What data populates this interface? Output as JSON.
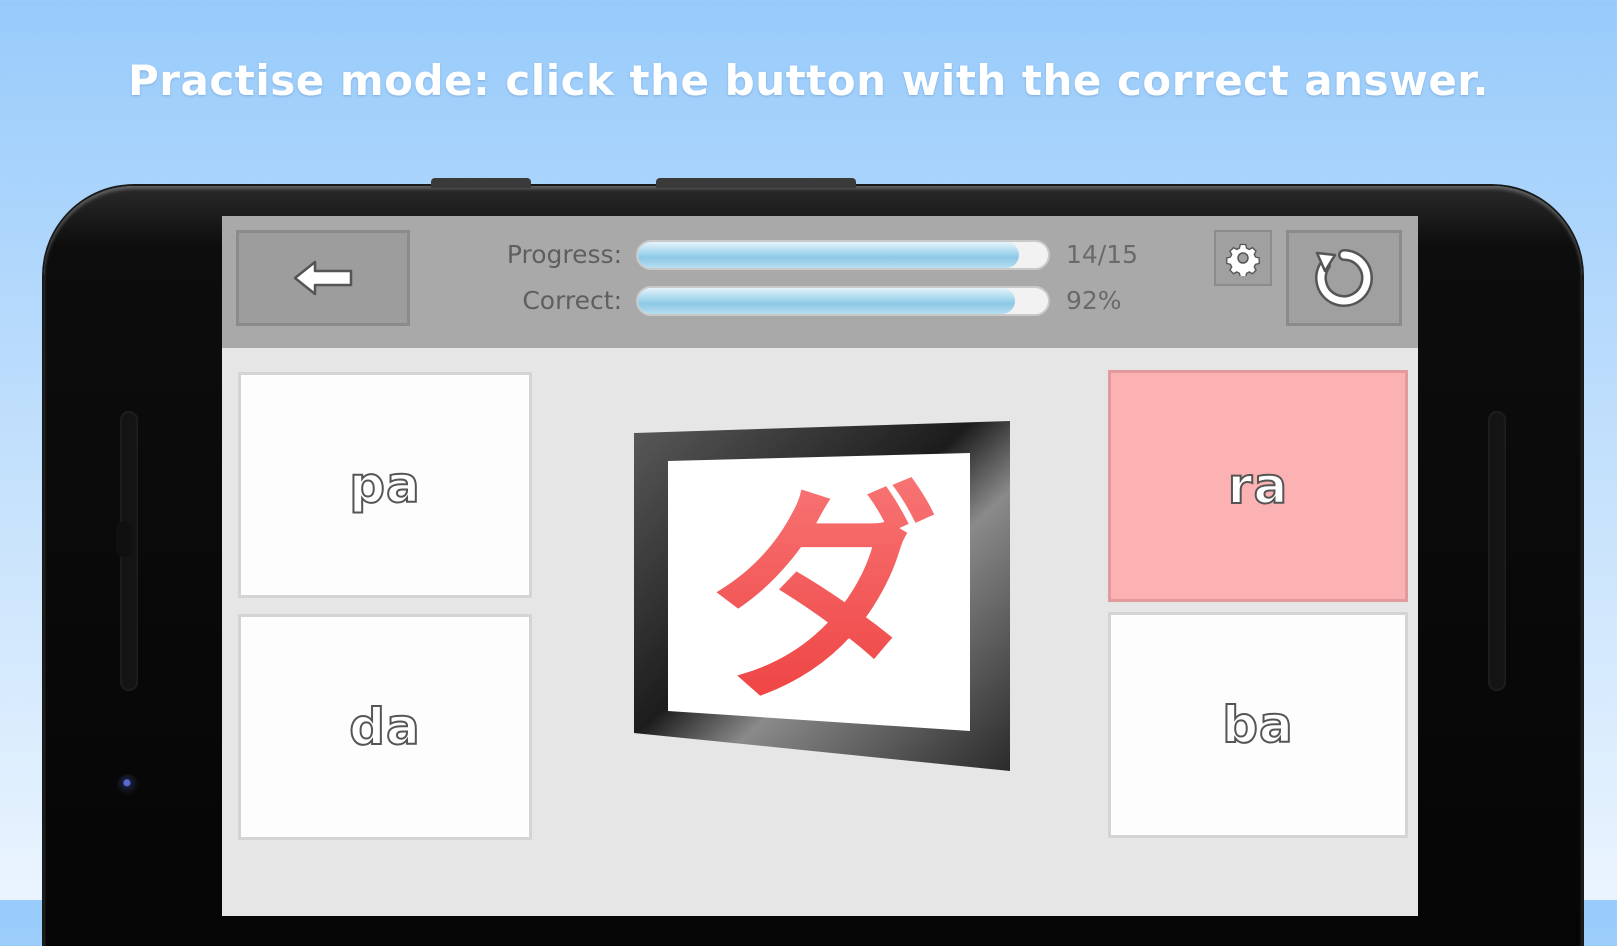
{
  "headline": "Practise mode: click the button with the correct answer.",
  "toolbar": {
    "progress_label": "Progress:",
    "progress_value": "14/15",
    "progress_fraction": 0.93,
    "correct_label": "Correct:",
    "correct_value": "92%",
    "correct_fraction": 0.92
  },
  "question": {
    "character": "ダ",
    "color": "#f04848"
  },
  "answers": {
    "top_left": "pa",
    "bottom_left": "da",
    "top_right": "ra",
    "bottom_right": "ba"
  },
  "colors": {
    "wrong_answer": "#fcb1b2",
    "sky": "#98cbfb"
  },
  "icons": [
    "back-arrow-icon",
    "gear-icon",
    "reset-icon"
  ]
}
